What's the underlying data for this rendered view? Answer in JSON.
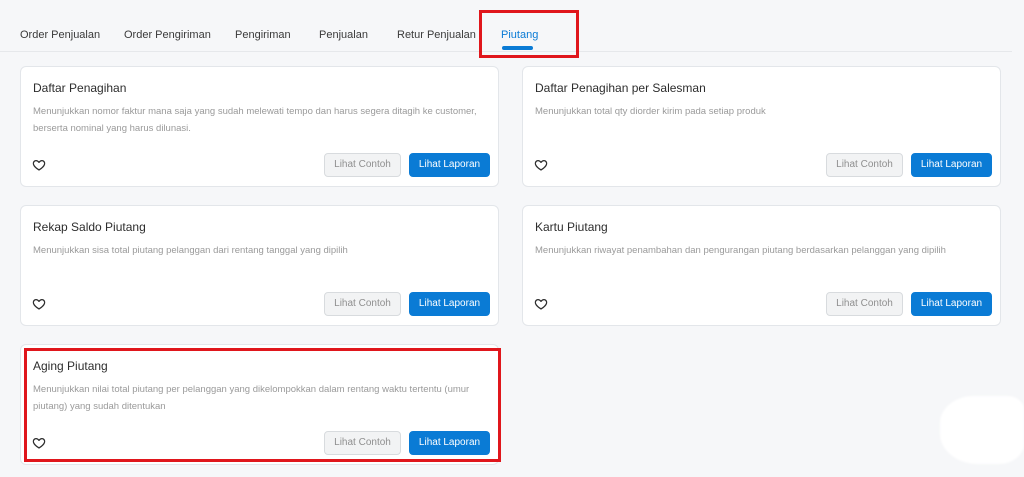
{
  "tabs": [
    {
      "label": "Order Penjualan"
    },
    {
      "label": "Order Pengiriman"
    },
    {
      "label": "Pengiriman"
    },
    {
      "label": "Penjualan"
    },
    {
      "label": "Retur Penjualan"
    },
    {
      "label": "Piutang",
      "active": true
    }
  ],
  "cards": [
    {
      "title": "Daftar Penagihan",
      "description": "Menunjukkan nomor faktur mana saja yang sudah melewati tempo dan harus segera ditagih ke customer, berserta nominal yang harus dilunasi.",
      "sample_label": "Lihat Contoh",
      "report_label": "Lihat Laporan"
    },
    {
      "title": "Daftar Penagihan per Salesman",
      "description": "Menunjukkan total qty diorder kirim pada setiap produk",
      "sample_label": "Lihat Contoh",
      "report_label": "Lihat Laporan"
    },
    {
      "title": "Rekap Saldo Piutang",
      "description": "Menunjukkan sisa total piutang pelanggan dari rentang tanggal yang dipilih",
      "sample_label": "Lihat Contoh",
      "report_label": "Lihat Laporan"
    },
    {
      "title": "Kartu Piutang",
      "description": "Menunjukkan riwayat penambahan dan pengurangan piutang berdasarkan pelanggan yang dipilih",
      "sample_label": "Lihat Contoh",
      "report_label": "Lihat Laporan"
    },
    {
      "title": "Aging Piutang",
      "description": "Menunjukkan nilai total piutang per pelanggan yang dikelompokkan dalam rentang waktu tertentu (umur piutang) yang sudah ditentukan",
      "sample_label": "Lihat Contoh",
      "report_label": "Lihat Laporan"
    }
  ],
  "colors": {
    "accent": "#0a7bd5",
    "highlight": "#e0161c"
  },
  "icons": {
    "favorite": "heart-icon"
  }
}
